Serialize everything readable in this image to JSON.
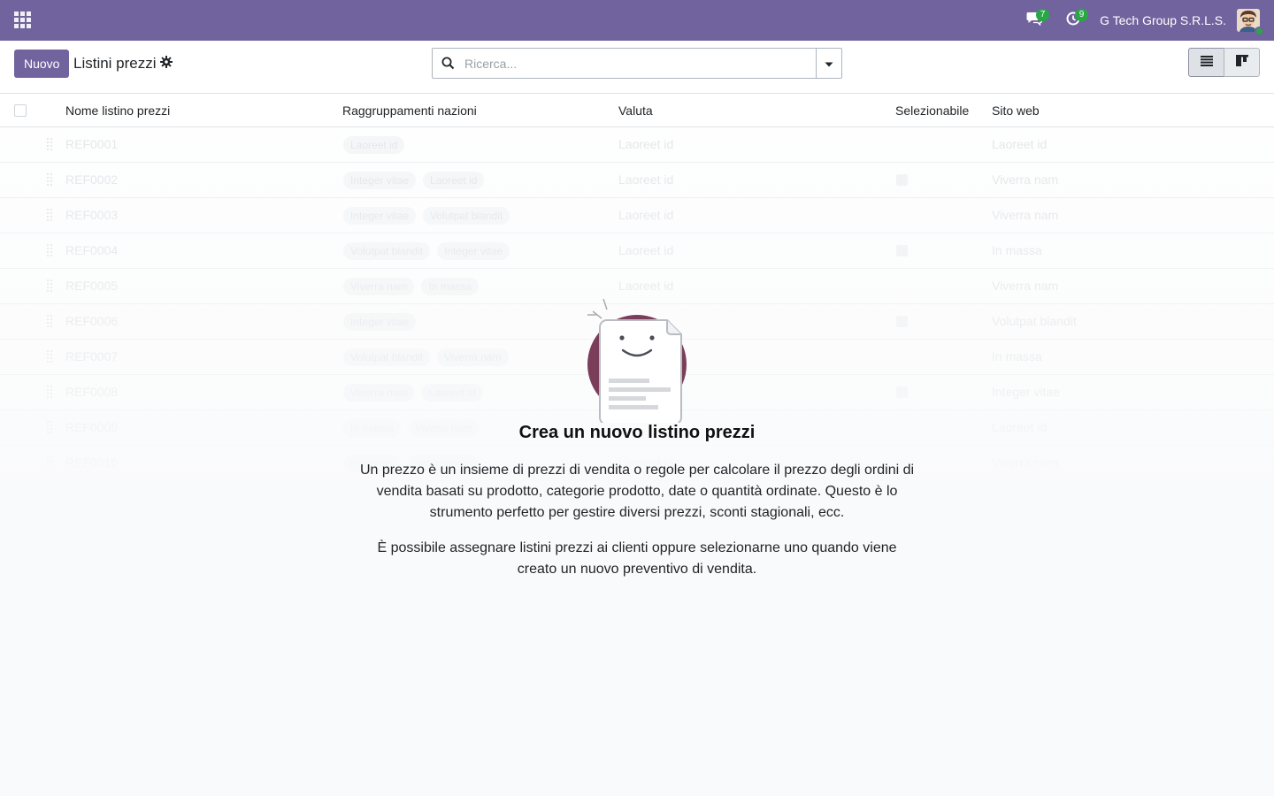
{
  "navbar": {
    "messages_count": "7",
    "activities_count": "9",
    "company": "G Tech Group S.R.L.S."
  },
  "control_panel": {
    "new_button": "Nuovo",
    "breadcrumb": "Listini prezzi",
    "search_placeholder": "Ricerca..."
  },
  "table": {
    "headers": [
      "Nome listino prezzi",
      "Raggruppamenti nazioni",
      "Valuta",
      "Selezionabile",
      "Sito web"
    ],
    "rows": [
      {
        "name": "REF0001",
        "tags": [
          "Laoreet id"
        ],
        "currency": "Laoreet id",
        "selectable": false,
        "website": "Laoreet id"
      },
      {
        "name": "REF0002",
        "tags": [
          "Integer vitae",
          "Laoreet id"
        ],
        "currency": "Laoreet id",
        "selectable": true,
        "website": "Viverra nam"
      },
      {
        "name": "REF0003",
        "tags": [
          "Integer vitae",
          "Volutpat blandit"
        ],
        "currency": "Laoreet id",
        "selectable": false,
        "website": "Viverra nam"
      },
      {
        "name": "REF0004",
        "tags": [
          "Volutpat blandit",
          "Integer vitae"
        ],
        "currency": "Laoreet id",
        "selectable": true,
        "website": "In massa"
      },
      {
        "name": "REF0005",
        "tags": [
          "Viverra nam",
          "In massa"
        ],
        "currency": "Laoreet id",
        "selectable": false,
        "website": "Viverra nam"
      },
      {
        "name": "REF0006",
        "tags": [
          "Integer vitae"
        ],
        "currency": "",
        "selectable": true,
        "website": "Volutpat blandit"
      },
      {
        "name": "REF0007",
        "tags": [
          "Volutpat blandit",
          "Viverra nam"
        ],
        "currency": "",
        "selectable": false,
        "website": "In massa"
      },
      {
        "name": "REF0008",
        "tags": [
          "Viverra nam",
          "Laoreet id"
        ],
        "currency": "",
        "selectable": true,
        "website": "Integer vitae"
      },
      {
        "name": "REF0009",
        "tags": [
          "In massa",
          "Viverra nam"
        ],
        "currency": "",
        "selectable": false,
        "website": "Laoreet id"
      },
      {
        "name": "REF0010",
        "tags": [
          "In massa",
          "Viverra nam"
        ],
        "currency": "Laoreet id",
        "selectable": false,
        "website": "Viverra nam"
      }
    ]
  },
  "helper": {
    "title": "Crea un nuovo listino prezzi",
    "text1": "Un prezzo è un insieme di prezzi di vendita o regole per calcolare il prezzo degli ordini di vendita basati su prodotto, categorie prodotto, date o quantità ordinate. Questo è lo strumento perfetto per gestire diversi prezzi, sconti stagionali, ecc.",
    "text2": "È possibile assegnare listini prezzi ai clienti oppure selezionarne uno quando viene creato un nuovo preventivo di vendita."
  },
  "colors": {
    "brand": "#71639e",
    "badge": "#28a745",
    "illustration_circle": "#7a3e5a"
  },
  "icons": [
    "apps-grid-icon",
    "chat-icon",
    "clock-icon",
    "avatar",
    "gear-icon",
    "search-icon",
    "caret-down-icon",
    "list-view-icon",
    "kanban-view-icon",
    "drag-handle-icon"
  ]
}
